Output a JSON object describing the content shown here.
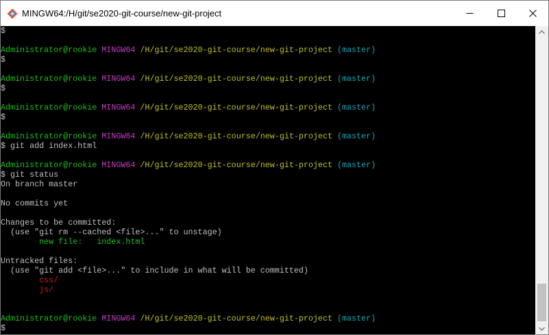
{
  "window": {
    "title": "MINGW64:/H/git/se2020-git-course/new-git-project",
    "app_icon": "git-bash-icon",
    "controls": [
      "minimize-icon",
      "maximize-icon",
      "close-icon"
    ]
  },
  "colors": {
    "user": "#1dbf1d",
    "msystem": "#c43bc4",
    "path": "#c0c028",
    "branch": "#1ea7b8",
    "text": "#c0c0c0",
    "staged": "#1dbf1d",
    "untracked": "#c81e1e"
  },
  "terminal": {
    "lines": [
      {
        "type": "text",
        "text": "$"
      },
      {
        "type": "blank",
        "text": ""
      },
      {
        "type": "prompt",
        "user": "Administrator@rookie",
        "msystem": "MINGW64",
        "path": "/H/git/se2020-git-course/new-git-project",
        "branch": "(master)"
      },
      {
        "type": "text",
        "text": "$"
      },
      {
        "type": "blank",
        "text": ""
      },
      {
        "type": "prompt",
        "user": "Administrator@rookie",
        "msystem": "MINGW64",
        "path": "/H/git/se2020-git-course/new-git-project",
        "branch": "(master)"
      },
      {
        "type": "text",
        "text": "$"
      },
      {
        "type": "blank",
        "text": ""
      },
      {
        "type": "prompt",
        "user": "Administrator@rookie",
        "msystem": "MINGW64",
        "path": "/H/git/se2020-git-course/new-git-project",
        "branch": "(master)"
      },
      {
        "type": "text",
        "text": "$"
      },
      {
        "type": "blank",
        "text": ""
      },
      {
        "type": "prompt",
        "user": "Administrator@rookie",
        "msystem": "MINGW64",
        "path": "/H/git/se2020-git-course/new-git-project",
        "branch": "(master)"
      },
      {
        "type": "text",
        "text": "$ git add index.html"
      },
      {
        "type": "blank",
        "text": ""
      },
      {
        "type": "prompt",
        "user": "Administrator@rookie",
        "msystem": "MINGW64",
        "path": "/H/git/se2020-git-course/new-git-project",
        "branch": "(master)"
      },
      {
        "type": "text",
        "text": "$ git status"
      },
      {
        "type": "text",
        "text": "On branch master"
      },
      {
        "type": "blank",
        "text": ""
      },
      {
        "type": "text",
        "text": "No commits yet"
      },
      {
        "type": "blank",
        "text": ""
      },
      {
        "type": "text",
        "text": "Changes to be committed:"
      },
      {
        "type": "text",
        "text": "  (use \"git rm --cached <file>...\" to unstage)"
      },
      {
        "type": "staged",
        "text": "        new file:   index.html"
      },
      {
        "type": "blank",
        "text": ""
      },
      {
        "type": "text",
        "text": "Untracked files:"
      },
      {
        "type": "text",
        "text": "  (use \"git add <file>...\" to include in what will be committed)"
      },
      {
        "type": "untracked",
        "text": "        css/"
      },
      {
        "type": "untracked",
        "text": "        js/"
      },
      {
        "type": "blank",
        "text": ""
      },
      {
        "type": "blank",
        "text": ""
      },
      {
        "type": "prompt",
        "user": "Administrator@rookie",
        "msystem": "MINGW64",
        "path": "/H/git/se2020-git-course/new-git-project",
        "branch": "(master)"
      },
      {
        "type": "text",
        "text": "$"
      }
    ]
  },
  "scrollbar": {
    "up_icon": "scroll-up-arrow-icon",
    "down_icon": "scroll-down-arrow-icon",
    "position": 1.0
  }
}
